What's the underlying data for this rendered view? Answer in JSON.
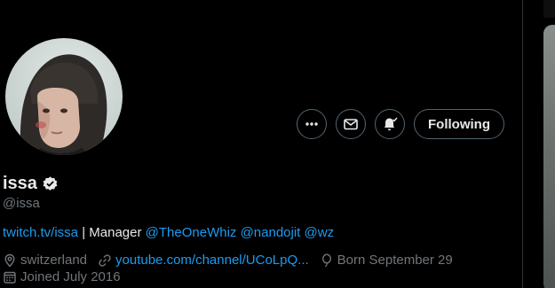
{
  "profile": {
    "display_name": "issa",
    "handle": "@issa",
    "verified_icon": "verified-badge-icon"
  },
  "actions": {
    "more_icon": "more-icon",
    "message_icon": "mail-icon",
    "notify_icon": "notification-bell-icon",
    "following_label": "Following"
  },
  "bio": {
    "link": "twitch.tv/issa",
    "separator": " | ",
    "role": "Manager ",
    "mention1": "@TheOneWhiz",
    "mention2": "@nandojit",
    "mention3": "@wz"
  },
  "meta": {
    "location": "switzerland",
    "website": "youtube.com/channel/UCoLpQ...",
    "birthday": "Born September 29",
    "joined": "Joined July 2016"
  },
  "colors": {
    "background": "#000000",
    "text_primary": "#e7e9ea",
    "text_secondary": "#71767b",
    "link": "#1d9bf0",
    "border": "#536471"
  }
}
